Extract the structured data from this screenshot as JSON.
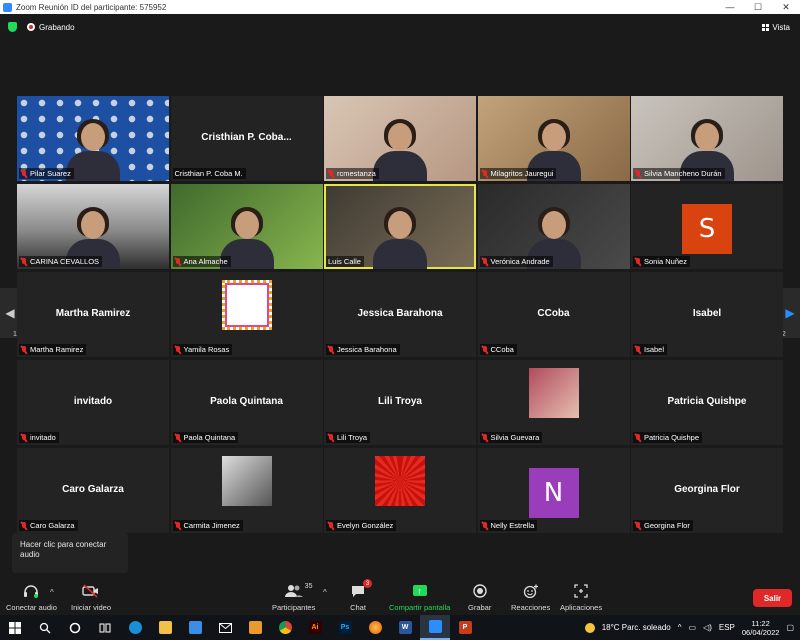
{
  "window": {
    "title": "Zoom Reunión ID del participante: 575952",
    "minimize": "—",
    "maximize": "☐",
    "close": "✕"
  },
  "topbar": {
    "recording_label": "Grabando",
    "view_label": "Vista"
  },
  "gallery": {
    "tiles": [
      {
        "name": "Pilar Suarez",
        "big": "",
        "kind": "video",
        "style": "v-oas",
        "muted": true
      },
      {
        "name": "Cristhian P. Coba M.",
        "big": "Cristhian P. Coba...",
        "kind": "name",
        "muted": false
      },
      {
        "name": "rcmestanza",
        "big": "",
        "kind": "video",
        "style": "v-warm",
        "muted": true
      },
      {
        "name": "Milagritos Jauregui",
        "big": "",
        "kind": "video",
        "style": "v-shop",
        "muted": true
      },
      {
        "name": "Silvia Mancheno Durán",
        "big": "",
        "kind": "video",
        "style": "v-room",
        "muted": true
      },
      {
        "name": "CARINA CEVALLOS",
        "big": "",
        "kind": "video",
        "style": "v-win",
        "muted": true
      },
      {
        "name": "Ana Almache",
        "big": "",
        "kind": "video",
        "style": "v-green",
        "muted": true
      },
      {
        "name": "Luis Calle",
        "big": "",
        "kind": "video",
        "style": "v-office",
        "muted": false,
        "active": true
      },
      {
        "name": "Verónica Andrade",
        "big": "",
        "kind": "video",
        "style": "v-teal",
        "muted": true
      },
      {
        "name": "Sonia Nuñez",
        "big": "S",
        "kind": "avatar-s",
        "muted": true
      },
      {
        "name": "Martha Ramirez",
        "big": "Martha Ramirez",
        "kind": "name",
        "muted": true
      },
      {
        "name": "Yamila Rosas",
        "big": "",
        "kind": "photo",
        "style": "ph-flower",
        "muted": true
      },
      {
        "name": "Jessica Barahona",
        "big": "Jessica Barahona",
        "kind": "name",
        "muted": true
      },
      {
        "name": "CCoba",
        "big": "CCoba",
        "kind": "name",
        "muted": true
      },
      {
        "name": "Isabel",
        "big": "Isabel",
        "kind": "name",
        "muted": true
      },
      {
        "name": "invitado",
        "big": "invitado",
        "kind": "name",
        "muted": true
      },
      {
        "name": "Paola Quintana",
        "big": "Paola Quintana",
        "kind": "name",
        "muted": true
      },
      {
        "name": "Lili Troya",
        "big": "Lili Troya",
        "kind": "name",
        "muted": true
      },
      {
        "name": "Silvia Guevara",
        "big": "",
        "kind": "photo",
        "style": "ph-silvia",
        "muted": true
      },
      {
        "name": "Patricia Quishpe",
        "big": "Patricia Quishpe",
        "kind": "name",
        "muted": true
      },
      {
        "name": "Caro Galarza",
        "big": "Caro Galarza",
        "kind": "name",
        "muted": true
      },
      {
        "name": "Carmita Jimenez",
        "big": "",
        "kind": "photo",
        "style": "ph-carmita",
        "muted": true
      },
      {
        "name": "Evelyn González",
        "big": "",
        "kind": "photo",
        "style": "ph-red",
        "muted": true
      },
      {
        "name": "Nelly Estrella",
        "big": "N",
        "kind": "avatar-n",
        "muted": true
      },
      {
        "name": "Georgina Flor",
        "big": "Georgina Flor",
        "kind": "name",
        "muted": true
      }
    ],
    "page_left": "1/2",
    "page_right": "1/2"
  },
  "tooltip": {
    "text": "Hacer clic para conectar audio"
  },
  "toolbar": {
    "audio_label": "Conectar audio",
    "video_label": "Iniciar video",
    "participants_label": "Participantes",
    "participants_count": "35",
    "chat_label": "Chat",
    "chat_badge": "3",
    "share_label": "Compartir pantalla",
    "record_label": "Grabar",
    "reactions_label": "Reacciones",
    "apps_label": "Aplicaciones",
    "leave_label": "Salir"
  },
  "taskbar": {
    "weather": "18°C  Parc. soleado",
    "lang": "ESP",
    "time": "11:22",
    "date": "06/04/2022"
  }
}
